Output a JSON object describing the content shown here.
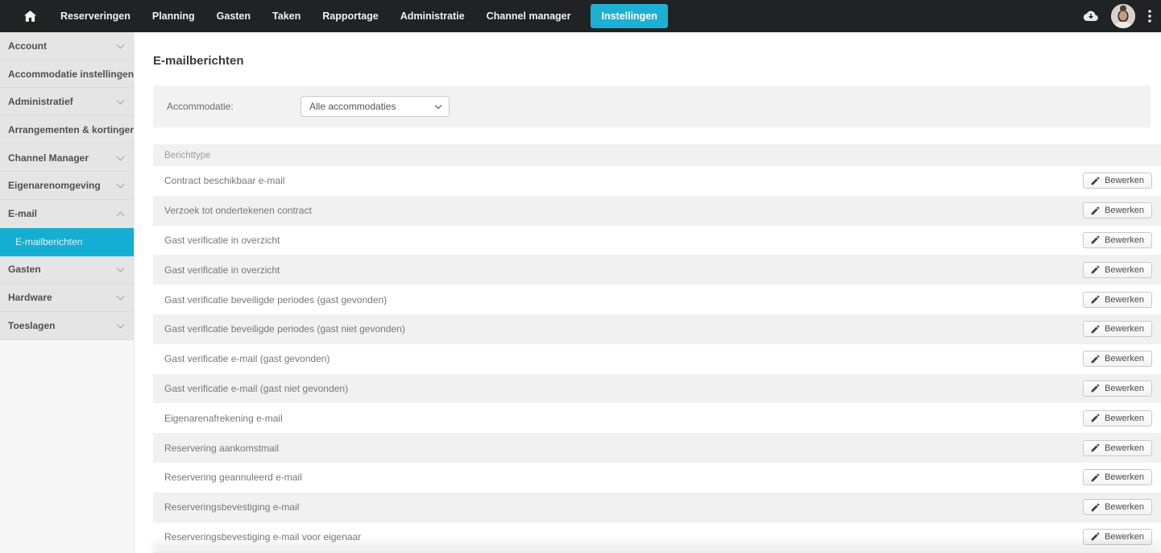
{
  "topnav": {
    "items": [
      {
        "label": "Reserveringen",
        "active": false
      },
      {
        "label": "Planning",
        "active": false
      },
      {
        "label": "Gasten",
        "active": false
      },
      {
        "label": "Taken",
        "active": false
      },
      {
        "label": "Rapportage",
        "active": false
      },
      {
        "label": "Administratie",
        "active": false
      },
      {
        "label": "Channel manager",
        "active": false
      },
      {
        "label": "Instellingen",
        "active": true
      }
    ],
    "icons": [
      "home-icon",
      "cloud-download-icon",
      "avatar",
      "kebab-menu-icon"
    ]
  },
  "sidebar": {
    "items": [
      {
        "label": "Account",
        "chevron": "down",
        "sub": false,
        "active": false
      },
      {
        "label": "Accommodatie instellingen",
        "chevron": "down",
        "sub": false,
        "active": false
      },
      {
        "label": "Administratief",
        "chevron": "down",
        "sub": false,
        "active": false
      },
      {
        "label": "Arrangementen & kortingen",
        "chevron": "down",
        "sub": false,
        "active": false
      },
      {
        "label": "Channel Manager",
        "chevron": "down",
        "sub": false,
        "active": false
      },
      {
        "label": "Eigenarenomgeving",
        "chevron": "down",
        "sub": false,
        "active": false
      },
      {
        "label": "E-mail",
        "chevron": "up",
        "sub": false,
        "active": false
      },
      {
        "label": "E-mailberichten",
        "chevron": "none",
        "sub": true,
        "active": true
      },
      {
        "label": "Gasten",
        "chevron": "down",
        "sub": false,
        "active": false
      },
      {
        "label": "Hardware",
        "chevron": "down",
        "sub": false,
        "active": false
      },
      {
        "label": "Toeslagen",
        "chevron": "down",
        "sub": false,
        "active": false
      }
    ]
  },
  "main": {
    "title": "E-mailberichten",
    "filter": {
      "label": "Accommodatie:",
      "selected": "Alle accommodaties"
    },
    "table": {
      "header": "Berichttype",
      "edit_label": "Bewerken",
      "rows": [
        "Contract beschikbaar e-mail",
        "Verzoek tot ondertekenen contract",
        "Gast verificatie in overzicht",
        "Gast verificatie in overzicht",
        "Gast verificatie beveiligde periodes (gast gevonden)",
        "Gast verificatie beveiligde periodes (gast niet gevonden)",
        "Gast verificatie e-mail (gast gevonden)",
        "Gast verificatie e-mail (gast niet gevonden)",
        "Eigenarenafrekening e-mail",
        "Reservering aankomstmail",
        "Reservering geannuleerd e-mail",
        "Reserveringsbevestiging e-mail",
        "Reserveringsbevestiging e-mail voor eigenaar"
      ]
    }
  },
  "colors": {
    "accent_cyan": "#14aed2",
    "topnav_bg": "#212224",
    "sidebar_bg": "#e5e5e5",
    "stripe_gray": "#f1f1f1"
  }
}
